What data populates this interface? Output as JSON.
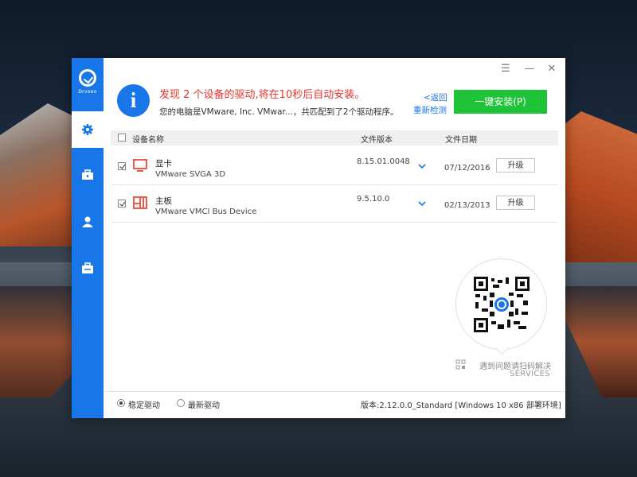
{
  "app": {
    "logo_text": "Drvoeo",
    "colors": {
      "accent": "#1976e8",
      "install": "#1ec337",
      "alert": "#e5342a"
    }
  },
  "sidebar": {
    "items": [
      {
        "id": "drivers",
        "icon": "gear-icon",
        "active": true
      },
      {
        "id": "toolbox",
        "icon": "toolbox-icon",
        "active": false
      },
      {
        "id": "user",
        "icon": "user-icon",
        "active": false
      },
      {
        "id": "backup",
        "icon": "briefcase-icon",
        "active": false
      }
    ]
  },
  "window_controls": {
    "menu": "☰",
    "minimize": "—",
    "close": "✕"
  },
  "header": {
    "headline": "发现 2 个设备的驱动,将在10秒后自动安装。",
    "subline": "您的电脑是VMware, Inc. VMwar...，共匹配到了2个驱动程序。",
    "back_link": "<返回",
    "recheck_link": "重新检测",
    "install_button": "一键安装(P)"
  },
  "table": {
    "columns": {
      "device": "设备名称",
      "version": "文件版本",
      "date": "文件日期"
    },
    "rows": [
      {
        "category": "显卡",
        "model": "VMware SVGA 3D",
        "version": "8.15.01.0048",
        "date": "07/12/2016",
        "action": "升级",
        "checked": true,
        "icon": "monitor-icon"
      },
      {
        "category": "主板",
        "model": "VMware VMCI Bus Device",
        "version": "9.5.10.0",
        "date": "02/13/2013",
        "action": "升级",
        "checked": true,
        "icon": "motherboard-icon"
      }
    ]
  },
  "service": {
    "label": "遇到问题请扫码解决",
    "sub": "SERVICES"
  },
  "footer": {
    "option_stable": "稳定驱动",
    "option_latest": "最新驱动",
    "selected": "stable",
    "version_info": "版本:2.12.0.0_Standard [Windows 10 x86 部署环境]"
  }
}
